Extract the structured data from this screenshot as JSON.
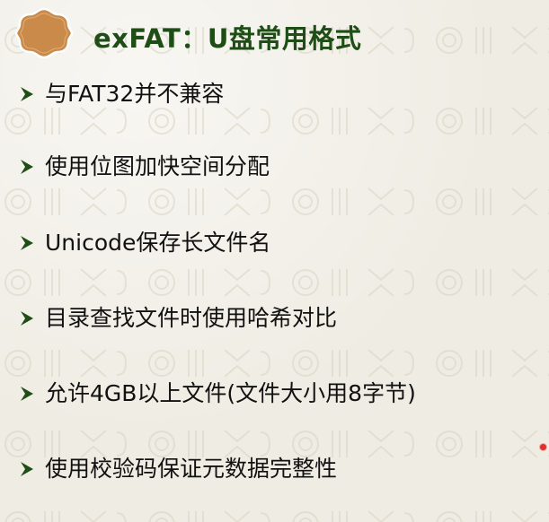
{
  "slide": {
    "title": "exFAT：U盘常用格式",
    "bullets": [
      "与FAT32并不兼容",
      "使用位图加快空间分配",
      "Unicode保存长文件名",
      "目录查找文件时使用哈希对比",
      "允许4GB以上文件(文件大小用8字节)",
      "使用校验码保证元数据完整性"
    ]
  },
  "colors": {
    "title": "#1e4d16",
    "bullet_arrow": "#1e4d16",
    "badge_fill": "#c98a4a",
    "badge_stroke": "#ffffff",
    "text": "#111111",
    "background": "#efece3",
    "pointer_dot": "#e0302a"
  },
  "icons": {
    "title_badge": "scalloped-badge-icon",
    "bullet_marker": "arrow-bullet-icon"
  }
}
